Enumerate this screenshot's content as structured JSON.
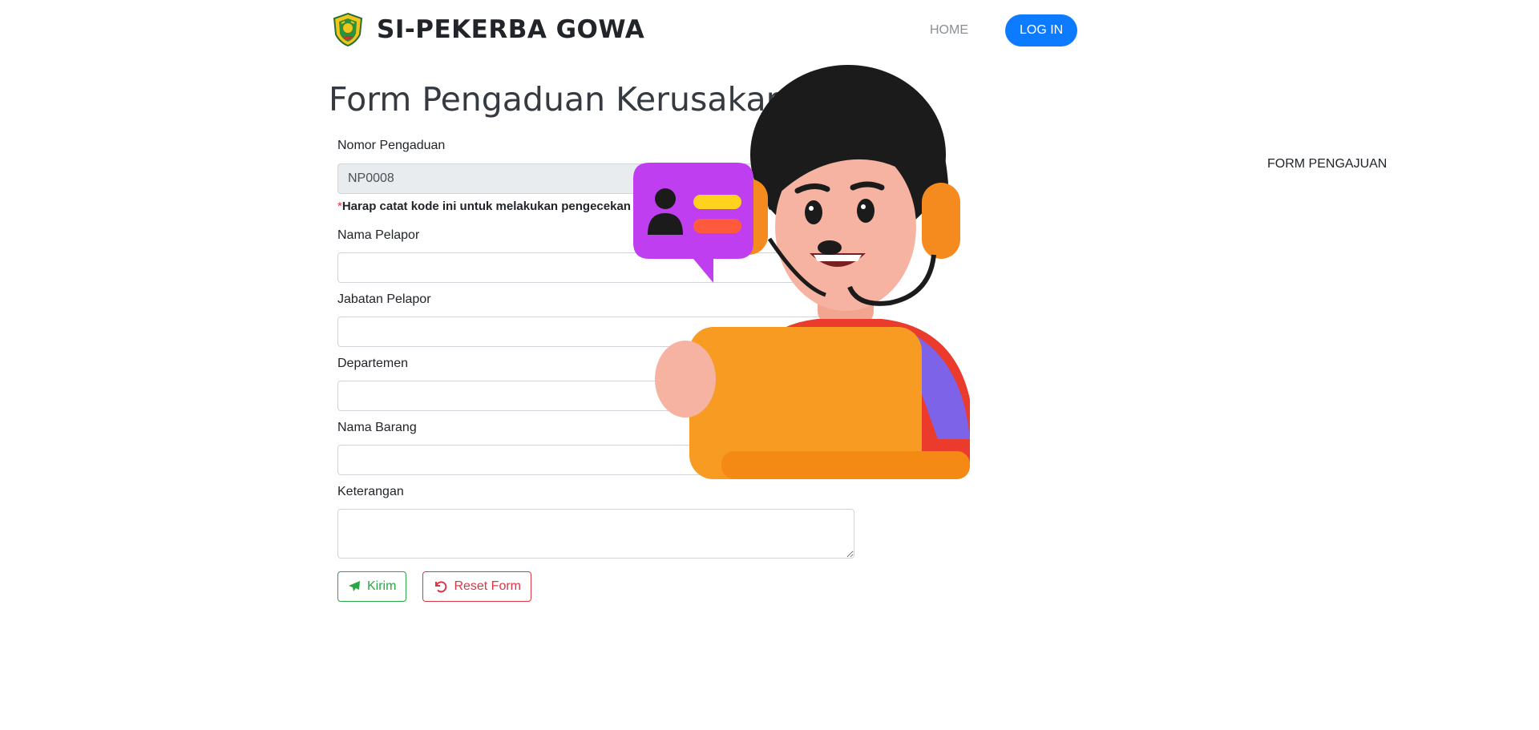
{
  "brand": {
    "name": "SI-PEKERBA GOWA"
  },
  "nav": {
    "home": "HOME",
    "form": "FORM PENGAJUAN",
    "login": "LOG IN"
  },
  "page": {
    "title": "Form Pengaduan Kerusakan Barang"
  },
  "form": {
    "nomor": {
      "label": "Nomor Pengaduan",
      "value": "NP0008"
    },
    "note": {
      "asterisk": "*",
      "text": "Harap catat kode ini untuk melakukan pengecekan sendiri melalui kolom pencarian."
    },
    "nama_pelapor": {
      "label": "Nama Pelapor",
      "value": ""
    },
    "jabatan_pelapor": {
      "label": "Jabatan Pelapor",
      "value": ""
    },
    "departemen": {
      "label": "Departemen",
      "value": ""
    },
    "nama_barang": {
      "label": "Nama Barang",
      "value": ""
    },
    "keterangan": {
      "label": "Keterangan",
      "value": ""
    },
    "submit_label": "Kirim",
    "reset_label": "Reset Form"
  },
  "colors": {
    "primary": "#0d7bff",
    "success": "#28a745",
    "danger": "#dc3545",
    "muted_nav": "#8a8f94"
  },
  "icons": {
    "logo": "gowa-emblem-icon",
    "send": "paper-plane-icon",
    "reset": "undo-icon",
    "illustration": "customer-service-agent-illustration"
  }
}
